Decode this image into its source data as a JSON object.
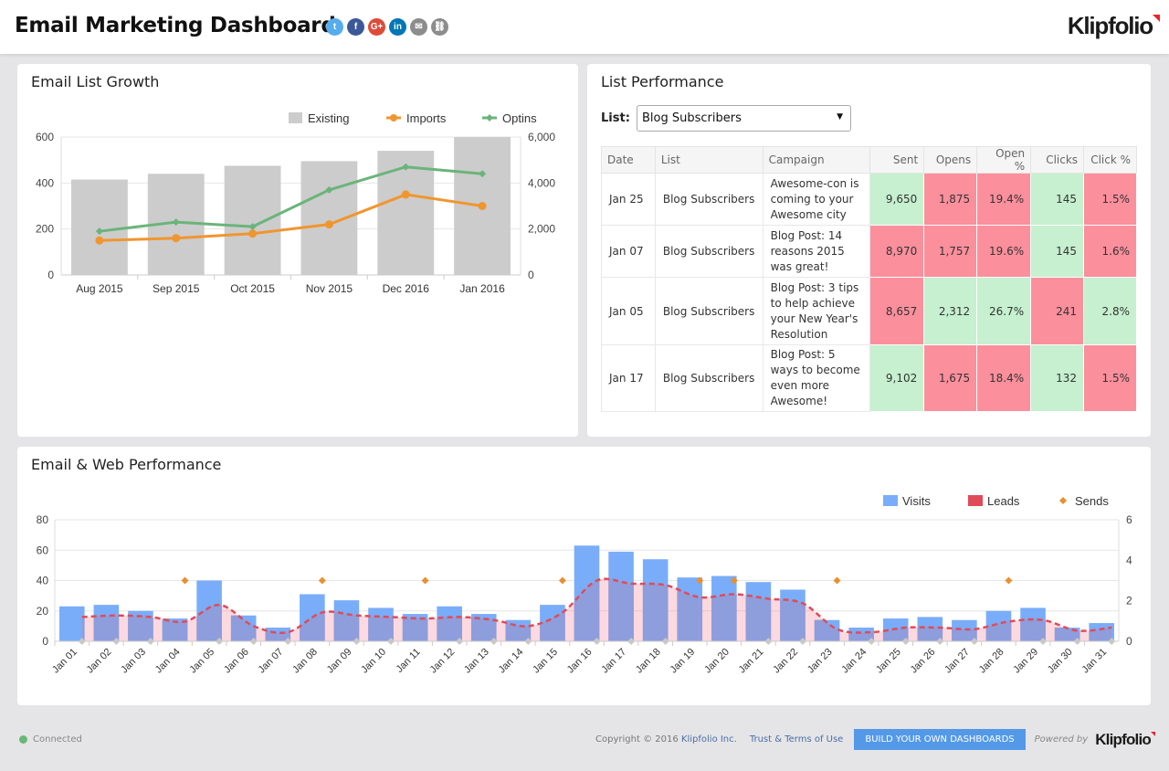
{
  "header": {
    "title": "Email Marketing Dashboard",
    "social_icons": [
      {
        "name": "twitter",
        "glyph": "t",
        "color": "#55acee"
      },
      {
        "name": "facebook",
        "glyph": "f",
        "color": "#3b5998"
      },
      {
        "name": "google-plus",
        "glyph": "G+",
        "color": "#dd4b39"
      },
      {
        "name": "linkedin",
        "glyph": "in",
        "color": "#0077b5"
      },
      {
        "name": "email",
        "glyph": "✉",
        "color": "#8c8c8c"
      },
      {
        "name": "link",
        "glyph": "⛓",
        "color": "#8c8c8c"
      }
    ],
    "logo": "Klipfolio"
  },
  "panels": {
    "list_growth": {
      "title": "Email List Growth"
    },
    "list_performance": {
      "title": "List Performance",
      "list_label": "List:",
      "list_selected": "Blog Subscribers",
      "columns": [
        "Date",
        "List",
        "Campaign",
        "Sent",
        "Opens",
        "Open %",
        "Clicks",
        "Click %"
      ],
      "rows": [
        {
          "date": "Jan 25",
          "list": "Blog Subscribers",
          "campaign": "Awesome-con is coming to your Awesome city",
          "sent": "9,650",
          "opens": "1,875",
          "open_pct": "19.4%",
          "clicks": "145",
          "click_pct": "1.5%",
          "status": [
            "g",
            "r",
            "r",
            "g",
            "r"
          ]
        },
        {
          "date": "Jan 07",
          "list": "Blog Subscribers",
          "campaign": "Blog Post: 14 reasons 2015 was great!",
          "sent": "8,970",
          "opens": "1,757",
          "open_pct": "19.6%",
          "clicks": "145",
          "click_pct": "1.6%",
          "status": [
            "r",
            "r",
            "r",
            "g",
            "r"
          ]
        },
        {
          "date": "Jan 05",
          "list": "Blog Subscribers",
          "campaign": "Blog Post: 3 tips to help achieve your New Year's Resolution",
          "sent": "8,657",
          "opens": "2,312",
          "open_pct": "26.7%",
          "clicks": "241",
          "click_pct": "2.8%",
          "status": [
            "r",
            "g",
            "g",
            "r",
            "g"
          ]
        },
        {
          "date": "Jan 17",
          "list": "Blog Subscribers",
          "campaign": "Blog Post: 5 ways to become even more Awesome!",
          "sent": "9,102",
          "opens": "1,675",
          "open_pct": "18.4%",
          "clicks": "132",
          "click_pct": "1.5%",
          "status": [
            "g",
            "r",
            "r",
            "g",
            "r"
          ]
        }
      ],
      "colors": {
        "good": "#c6f0cf",
        "bad": "#fc8f9c"
      }
    },
    "web_performance": {
      "title": "Email & Web Performance"
    }
  },
  "chart_data": [
    {
      "type": "bar",
      "title": "Email List Growth",
      "categories": [
        "Aug 2015",
        "Sep 2015",
        "Oct 2015",
        "Nov 2015",
        "Dec 2016",
        "Jan 2016"
      ],
      "series": [
        {
          "name": "Existing",
          "kind": "bar",
          "axis": "left",
          "color": "#cccccc",
          "values": [
            415,
            440,
            475,
            495,
            540,
            600
          ]
        },
        {
          "name": "Imports",
          "kind": "line",
          "axis": "left",
          "color": "#f0962e",
          "values": [
            150,
            160,
            180,
            220,
            350,
            300
          ]
        },
        {
          "name": "Optins",
          "kind": "line",
          "axis": "left",
          "color": "#6ab47a",
          "values": [
            190,
            230,
            210,
            370,
            470,
            440
          ]
        }
      ],
      "ylim": [
        0,
        600
      ],
      "yticks": [
        "0",
        "200",
        "400",
        "600"
      ],
      "y2lim": [
        0,
        6000
      ],
      "y2ticks": [
        "0",
        "2,000",
        "4,000",
        "6,000"
      ],
      "legend": "top-right",
      "grid": true
    },
    {
      "type": "bar",
      "title": "Email & Web Performance",
      "categories": [
        "Jan 01",
        "Jan 02",
        "Jan 03",
        "Jan 04",
        "Jan 05",
        "Jan 06",
        "Jan 07",
        "Jan 08",
        "Jan 09",
        "Jan 10",
        "Jan 11",
        "Jan 12",
        "Jan 13",
        "Jan 14",
        "Jan 15",
        "Jan 16",
        "Jan 17",
        "Jan 18",
        "Jan 19",
        "Jan 20",
        "Jan 21",
        "Jan 22",
        "Jan 23",
        "Jan 24",
        "Jan 25",
        "Jan 26",
        "Jan 27",
        "Jan 28",
        "Jan 29",
        "Jan 30",
        "Jan 31"
      ],
      "series": [
        {
          "name": "Visits",
          "kind": "bar",
          "axis": "left",
          "color": "#7aadf9",
          "values": [
            23,
            24,
            20,
            15,
            40,
            17,
            9,
            31,
            27,
            22,
            18,
            23,
            18,
            14,
            24,
            63,
            59,
            54,
            42,
            43,
            39,
            34,
            14,
            9,
            15,
            16,
            14,
            20,
            22,
            9,
            12
          ]
        },
        {
          "name": "Leads",
          "kind": "area-spline",
          "axis": "left",
          "color": "#e04b59",
          "values": [
            16,
            17,
            16,
            13,
            24,
            10,
            6,
            19,
            17,
            16,
            15,
            16,
            14,
            10,
            19,
            40,
            38,
            37,
            29,
            31,
            28,
            25,
            8,
            6,
            9,
            9,
            8,
            13,
            14,
            7,
            9
          ]
        },
        {
          "name": "Sends",
          "kind": "scatter",
          "axis": "right",
          "color": "#e8902f",
          "values": [
            0,
            0,
            0,
            3,
            0,
            0,
            0,
            3,
            0,
            0,
            3,
            0,
            0,
            0,
            3,
            0,
            0,
            0,
            3,
            3,
            0,
            0,
            3,
            0,
            0,
            0,
            0,
            3,
            0,
            0,
            0
          ]
        }
      ],
      "ylim": [
        0,
        80
      ],
      "yticks": [
        "0",
        "20",
        "40",
        "60",
        "80"
      ],
      "y2lim": [
        0,
        6
      ],
      "y2ticks": [
        "0",
        "2",
        "4",
        "6"
      ],
      "legend": "top-right",
      "grid": true
    }
  ],
  "footer": {
    "status": "Connected",
    "copyright": "Copyright © 2016 ",
    "copyright_link": "Klipfolio Inc.",
    "terms": "Trust & Terms of Use",
    "cta": "BUILD YOUR OWN DASHBOARDS",
    "powered_by": "Powered by",
    "logo": "Klipfolio"
  }
}
